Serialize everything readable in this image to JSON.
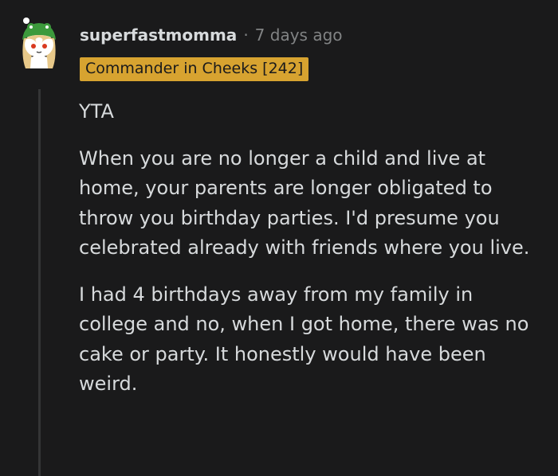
{
  "comment": {
    "author": "superfastmomma",
    "separator": "·",
    "timestamp": "7 days ago",
    "flair": "Commander in Cheeks [242]",
    "flair_color": "#d7a330",
    "avatar_icon": "snoo-avatar-icon",
    "paragraphs": [
      "YTA",
      "When you are no longer a child and live at home, your parents are longer obligated to throw you birthday parties. I'd presume you celebrated already with friends where you live.",
      "I had 4 birthdays away from my family in college and no, when I got home, there was no cake or party. It honestly would have been weird."
    ]
  }
}
